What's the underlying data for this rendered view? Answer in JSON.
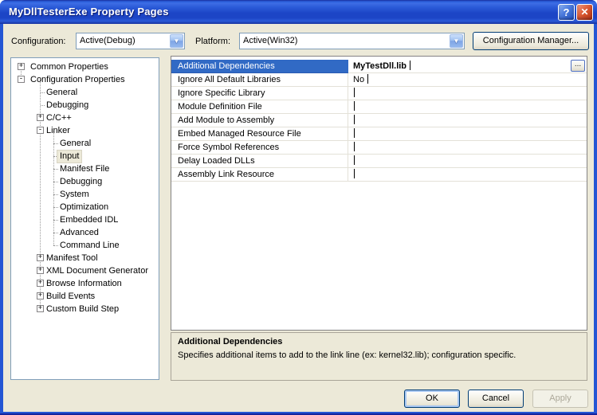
{
  "window": {
    "title": "MyDllTesterExe Property Pages",
    "help_icon": "?",
    "close_icon": "✕"
  },
  "toolbar": {
    "configuration_label": "Configuration:",
    "configuration_value": "Active(Debug)",
    "platform_label": "Platform:",
    "platform_value": "Active(Win32)",
    "configuration_manager_label": "Configuration Manager..."
  },
  "tree": {
    "items": [
      {
        "label": "Common Properties",
        "level": 0,
        "expander": "+"
      },
      {
        "label": "Configuration Properties",
        "level": 0,
        "expander": "-"
      },
      {
        "label": "General",
        "level": 1
      },
      {
        "label": "Debugging",
        "level": 1
      },
      {
        "label": "C/C++",
        "level": 1,
        "expander": "+"
      },
      {
        "label": "Linker",
        "level": 1,
        "expander": "-"
      },
      {
        "label": "General",
        "level": 2
      },
      {
        "label": "Input",
        "level": 2,
        "selected": true
      },
      {
        "label": "Manifest File",
        "level": 2
      },
      {
        "label": "Debugging",
        "level": 2
      },
      {
        "label": "System",
        "level": 2
      },
      {
        "label": "Optimization",
        "level": 2
      },
      {
        "label": "Embedded IDL",
        "level": 2
      },
      {
        "label": "Advanced",
        "level": 2
      },
      {
        "label": "Command Line",
        "level": 2
      },
      {
        "label": "Manifest Tool",
        "level": 1,
        "expander": "+"
      },
      {
        "label": "XML Document Generator",
        "level": 1,
        "expander": "+"
      },
      {
        "label": "Browse Information",
        "level": 1,
        "expander": "+"
      },
      {
        "label": "Build Events",
        "level": 1,
        "expander": "+"
      },
      {
        "label": "Custom Build Step",
        "level": 1,
        "expander": "+"
      }
    ]
  },
  "grid": {
    "selected_index": 0,
    "ellipsis_label": "...",
    "rows": [
      {
        "name": "Additional Dependencies",
        "value": "MyTestDll.lib"
      },
      {
        "name": "Ignore All Default Libraries",
        "value": "No"
      },
      {
        "name": "Ignore Specific Library",
        "value": ""
      },
      {
        "name": "Module Definition File",
        "value": ""
      },
      {
        "name": "Add Module to Assembly",
        "value": ""
      },
      {
        "name": "Embed Managed Resource File",
        "value": ""
      },
      {
        "name": "Force Symbol References",
        "value": ""
      },
      {
        "name": "Delay Loaded DLLs",
        "value": ""
      },
      {
        "name": "Assembly Link Resource",
        "value": ""
      }
    ]
  },
  "description": {
    "title": "Additional Dependencies",
    "body": "Specifies additional items to add to the link line (ex: kernel32.lib); configuration specific."
  },
  "footer": {
    "ok_label": "OK",
    "cancel_label": "Cancel",
    "apply_label": "Apply"
  },
  "colors": {
    "titlebar_top": "#3D6DE4",
    "titlebar_bottom": "#1C45C6",
    "window_border": "#2456D4",
    "selection_blue": "#316AC5",
    "content_bg": "#ECE9D8",
    "close_red": "#D8502E",
    "help_blue": "#3B6FD6"
  }
}
